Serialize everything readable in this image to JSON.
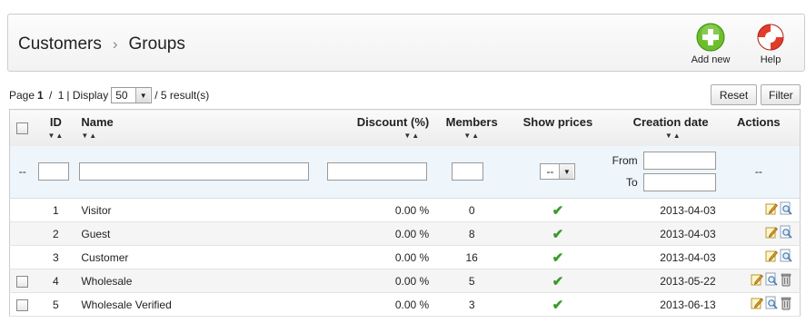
{
  "breadcrumb": {
    "root": "Customers",
    "separator": "›",
    "current": "Groups"
  },
  "toolbar": {
    "add_label": "Add new",
    "help_label": "Help"
  },
  "pager": {
    "page_prefix": "Page",
    "page_current": "1",
    "page_sep": " / ",
    "page_total": "1",
    "display_label": "| Display",
    "display_value": "50",
    "results": "/ 5 result(s)"
  },
  "buttons": {
    "reset": "Reset",
    "filter": "Filter"
  },
  "columns": {
    "id": "ID",
    "name": "Name",
    "discount": "Discount (%)",
    "members": "Members",
    "show_prices": "Show prices",
    "creation_date": "Creation date",
    "actions": "Actions"
  },
  "filter": {
    "dash_left": "--",
    "show_prices_value": "--",
    "from_label": "From",
    "to_label": "To",
    "dash_right": "--"
  },
  "rows": [
    {
      "id": "1",
      "name": "Visitor",
      "discount": "0.00 %",
      "members": "0",
      "date": "2013-04-03",
      "deletable": false
    },
    {
      "id": "2",
      "name": "Guest",
      "discount": "0.00 %",
      "members": "8",
      "date": "2013-04-03",
      "deletable": false
    },
    {
      "id": "3",
      "name": "Customer",
      "discount": "0.00 %",
      "members": "16",
      "date": "2013-04-03",
      "deletable": false
    },
    {
      "id": "4",
      "name": "Wholesale",
      "discount": "0.00 %",
      "members": "5",
      "date": "2013-05-22",
      "deletable": true
    },
    {
      "id": "5",
      "name": "Wholesale Verified",
      "discount": "0.00 %",
      "members": "3",
      "date": "2013-06-13",
      "deletable": true
    }
  ],
  "colors": {
    "accent_green": "#6cbf2a",
    "filter_bg": "#eef5fb",
    "check_green": "#3a9a2a"
  }
}
